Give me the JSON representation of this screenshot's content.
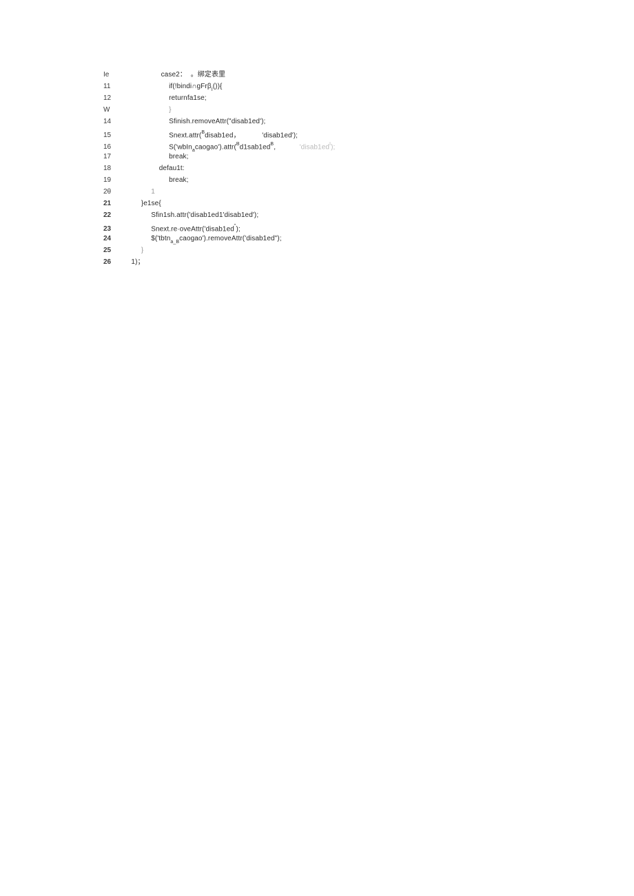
{
  "lines": [
    {
      "num": "Ie",
      "bold": false,
      "indent": "                    ",
      "text": "case2：",
      "extra": "。绑定表里",
      "extraClass": "cn"
    },
    {
      "num": "11",
      "bold": false,
      "indent": "                        ",
      "text": "",
      "parts": [
        {
          "t": "if(!bindi"
        },
        {
          "t": "∩",
          "cls": ""
        },
        {
          "t": "gFrβ"
        },
        {
          "t": "I",
          "cls": "sub"
        },
        {
          "t": "()){"
        }
      ]
    },
    {
      "num": "12",
      "bold": false,
      "indent": "                        ",
      "text": "returnfa1se;"
    },
    {
      "num": "W",
      "bold": false,
      "indent": "                        ",
      "text": "",
      "parts": [
        {
          "t": "}",
          "cls": "grey"
        }
      ]
    },
    {
      "num": "14",
      "bold": false,
      "indent": "                        ",
      "text": "",
      "parts": [
        {
          "t": "Sfinish.removeAttr("
        },
        {
          "t": "\"",
          "cls": ""
        },
        {
          "t": "disab1ed"
        },
        {
          "t": "'",
          "cls": ""
        },
        {
          "t": ");"
        }
      ]
    },
    {
      "num": "15",
      "bold": false,
      "indent": "                        ",
      "text": "",
      "parts": [
        {
          "t": "Snext.attr("
        },
        {
          "t": "B",
          "cls": "sup"
        },
        {
          "t": "disab1ed"
        },
        {
          "t": "，",
          "cls": ""
        },
        {
          "t": "           'disab1ed"
        },
        {
          "t": "'",
          "cls": ""
        },
        {
          "t": ");"
        }
      ]
    },
    {
      "num": "16",
      "bold": false,
      "indent": "                        ",
      "text": "",
      "parts": [
        {
          "t": "S("
        },
        {
          "t": "'",
          "cls": ""
        },
        {
          "t": "wbIn"
        },
        {
          "t": "a",
          "cls": "sub"
        },
        {
          "t": "caogao"
        },
        {
          "t": "'",
          "cls": ""
        },
        {
          "t": ")"
        },
        {
          "t": ".",
          "cls": ""
        },
        {
          "t": "attr("
        },
        {
          "t": "B",
          "cls": "sup"
        },
        {
          "t": "d1sab1ed"
        },
        {
          "t": "B",
          "cls": "sup"
        },
        {
          "t": ","
        },
        {
          "t": "            ",
          "cls": ""
        },
        {
          "t": "'disab1ed",
          "cls": "faint"
        },
        {
          "t": "I",
          "cls": "sup faint"
        },
        {
          "t": ");",
          "cls": "faint"
        }
      ]
    },
    {
      "num": "17",
      "bold": false,
      "indent": "                        ",
      "text": "break;"
    },
    {
      "num": "18",
      "bold": false,
      "indent": "                   ",
      "text": "defau1t:"
    },
    {
      "num": "19",
      "bold": false,
      "indent": "                        ",
      "text": "break;"
    },
    {
      "num": "2θ",
      "bold": false,
      "indent": "               ",
      "text": "",
      "parts": [
        {
          "t": "1",
          "cls": "grey"
        }
      ]
    },
    {
      "num": "21",
      "bold": true,
      "indent": "          ",
      "text": "}e1se{"
    },
    {
      "num": "22",
      "bold": true,
      "indent": "               ",
      "text": "",
      "parts": [
        {
          "t": "Sfin1sh.attr("
        },
        {
          "t": "'",
          "cls": ""
        },
        {
          "t": "disab1ed1'disab1ed');"
        }
      ]
    },
    {
      "num": "23",
      "bold": true,
      "indent": "               ",
      "text": "",
      "parts": [
        {
          "t": "Snext.re"
        },
        {
          "t": "·",
          "cls": ""
        },
        {
          "t": "oveAttr("
        },
        {
          "t": "'",
          "cls": ""
        },
        {
          "t": "disab1ed"
        },
        {
          "t": "\"",
          "cls": "sup"
        },
        {
          "t": ");"
        }
      ]
    },
    {
      "num": "24",
      "bold": true,
      "indent": "               ",
      "text": "",
      "parts": [
        {
          "t": "$('tbtn"
        },
        {
          "t": "a_B",
          "cls": "sub"
        },
        {
          "t": "caogao')"
        },
        {
          "t": ".",
          "cls": ""
        },
        {
          "t": "removeAttr("
        },
        {
          "t": "'",
          "cls": ""
        },
        {
          "t": "disab1ed\");"
        }
      ]
    },
    {
      "num": "25",
      "bold": true,
      "indent": "          ",
      "text": "",
      "parts": [
        {
          "t": "}",
          "cls": "grey"
        }
      ]
    },
    {
      "num": "26",
      "bold": true,
      "indent": "     ",
      "text": "1)；"
    }
  ]
}
